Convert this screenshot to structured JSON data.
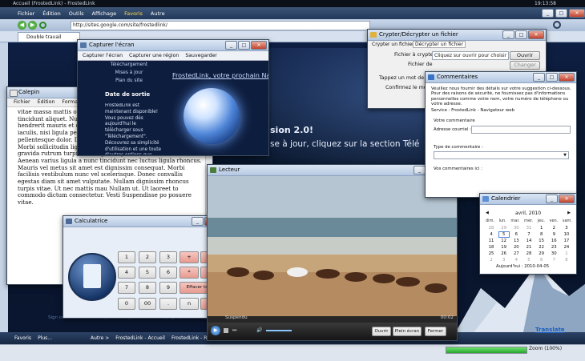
{
  "colors": {
    "ie_blue": "#1a3e86",
    "accent": "#2f6fd1",
    "progress_green": "#36c43f"
  },
  "taskbar_top": {
    "title": "Accueil (FrostedLink) - FrostedLink",
    "time": "19:13:58",
    "menu": [
      "Fichier",
      "Édition",
      "Outils",
      "Affichage",
      "Favoris",
      "Autre"
    ]
  },
  "browser": {
    "address": "http://sites.google.com/site/frostedlink/",
    "tab_label": "Double travail",
    "hero_text_1": "sion 2.0!",
    "hero_text_2": "se à jour, cliquez sur la section Télé",
    "links_faint": "Sign in   Recent Site Activity   Terms   Report Abuse   Print page   |   Powered By Google Sites",
    "status_zoom": "Zoom (100%)",
    "taskbar_items": [
      "Favoris",
      "Plus...",
      "Autre >",
      "FrostedLink - Accueil",
      "FrostedLink - Recherche"
    ]
  },
  "capture": {
    "title": "Capturer l'écran",
    "btn_screen": "Capturer l'écran",
    "btn_region": "Capturer une région",
    "btn_save": "Sauvegarder",
    "nav_items": [
      "Téléchargement",
      "Mises à jour",
      "Plan du site"
    ],
    "banner_link": "FrostedLink, votre prochain Navig",
    "release_heading": "Date de sortie",
    "release_body": "FrostedLink est maintenant disponible! Vous pouvez dès aujourd'hui le télécharger sous \"Téléchargement\". Découvrez sa simplicité d'utilisation et une toute d'autres options que"
  },
  "notepad": {
    "title": "Calepin",
    "menu": [
      "Fichier",
      "Édition",
      "Format"
    ],
    "text": "vitae massa mattis orna Vestibulum quis dui tur rhoncus vitae tincidunt aliquet. Nulla ornare co Suspendisse ac nunc sc hendrerit mauris et con Morbi feugiat, diam quis faucibus iaculis, nisi ligula pellentesque tortor, sed molestie metus nulla pellentesque dolor. Donec id enim urna, vitae tincidunt ligula. Morbi sollicitudin ligula vitae eros elementum aliquet. Nunc gravida rutrum turpis, ac vulputate justo consectetur eu. Aenean varius ligula a nunc tincidunt nec luctus ligula rhoncus. Mauris vel metus sit amet est dignissim consequat. Morbi facilisis vestibulum nunc vel scelerisque. Donec convallis egestas diam sit amet vulputate. Nullam dignissim rhoncus turpis vitae. Ut nec mattis mau Nullam ut. Ut laoreet to commodo dictum consectetur. Vesti Suspendisse po posuere vitae."
  },
  "calculator": {
    "title": "Calculatrice",
    "keys": [
      [
        "1",
        "2",
        "3",
        "+",
        "-"
      ],
      [
        "4",
        "5",
        "6",
        "*",
        "/"
      ],
      [
        "7",
        "8",
        "9",
        "Effacer tout"
      ],
      [
        "0",
        "00",
        ".",
        "n",
        "="
      ]
    ]
  },
  "crypt": {
    "title": "Crypter/Décrypter un fichier",
    "tab_encrypt": "Crypter un fichier",
    "tab_decrypt": "Décrypter un fichier",
    "lbl_file": "Fichier à crypter :",
    "file_value": "Cliquez sur ouvrir pour choisir le fi",
    "btn_open": "Ouvrir",
    "lbl_dest": "Fichier de",
    "btn_change": "Changer",
    "lbl_pw": "Tappez un mot de pa",
    "lbl_confirm": "Confirmez le mot"
  },
  "comments": {
    "title": "Commentaires",
    "intro": "Veuillez nous fournir des détails sur votre suggestion ci-dessous. Pour des raisons de sécurité, ne fournissez pas d'informations personnelles comme votre nom, votre numéro de téléphone ou votre adresse.",
    "service": "Service : FrostedLink - Navigateur web",
    "your_comment": "Votre commentaire",
    "email_label": "Adresse courriel :",
    "type_label": "Type de commentaire :",
    "comments_label": "Vos commentaires ici :"
  },
  "player": {
    "title": "Lecteur",
    "status": "Suspendu",
    "time": "00:02",
    "btn_open": "Ouvrir",
    "btn_fullscreen": "Plein écran",
    "btn_close": "Fermer"
  },
  "calendar": {
    "title": "Calendrier",
    "month": "avril, 2010",
    "weekdays": [
      "dim.",
      "lun.",
      "mar.",
      "mer.",
      "jeu.",
      "ven.",
      "sam."
    ],
    "weeks": [
      [
        "28",
        "29",
        "30",
        "31",
        "1",
        "2",
        "3"
      ],
      [
        "4",
        "5",
        "6",
        "7",
        "8",
        "9",
        "10"
      ],
      [
        "11",
        "12",
        "13",
        "14",
        "15",
        "16",
        "17"
      ],
      [
        "18",
        "19",
        "20",
        "21",
        "22",
        "23",
        "24"
      ],
      [
        "25",
        "26",
        "27",
        "28",
        "29",
        "30",
        "1"
      ],
      [
        "2",
        "3",
        "4",
        "5",
        "6",
        "7",
        "8"
      ]
    ],
    "today": "Aujourd'hui : 2010-04-05"
  },
  "translate": {
    "label": "Translate"
  }
}
